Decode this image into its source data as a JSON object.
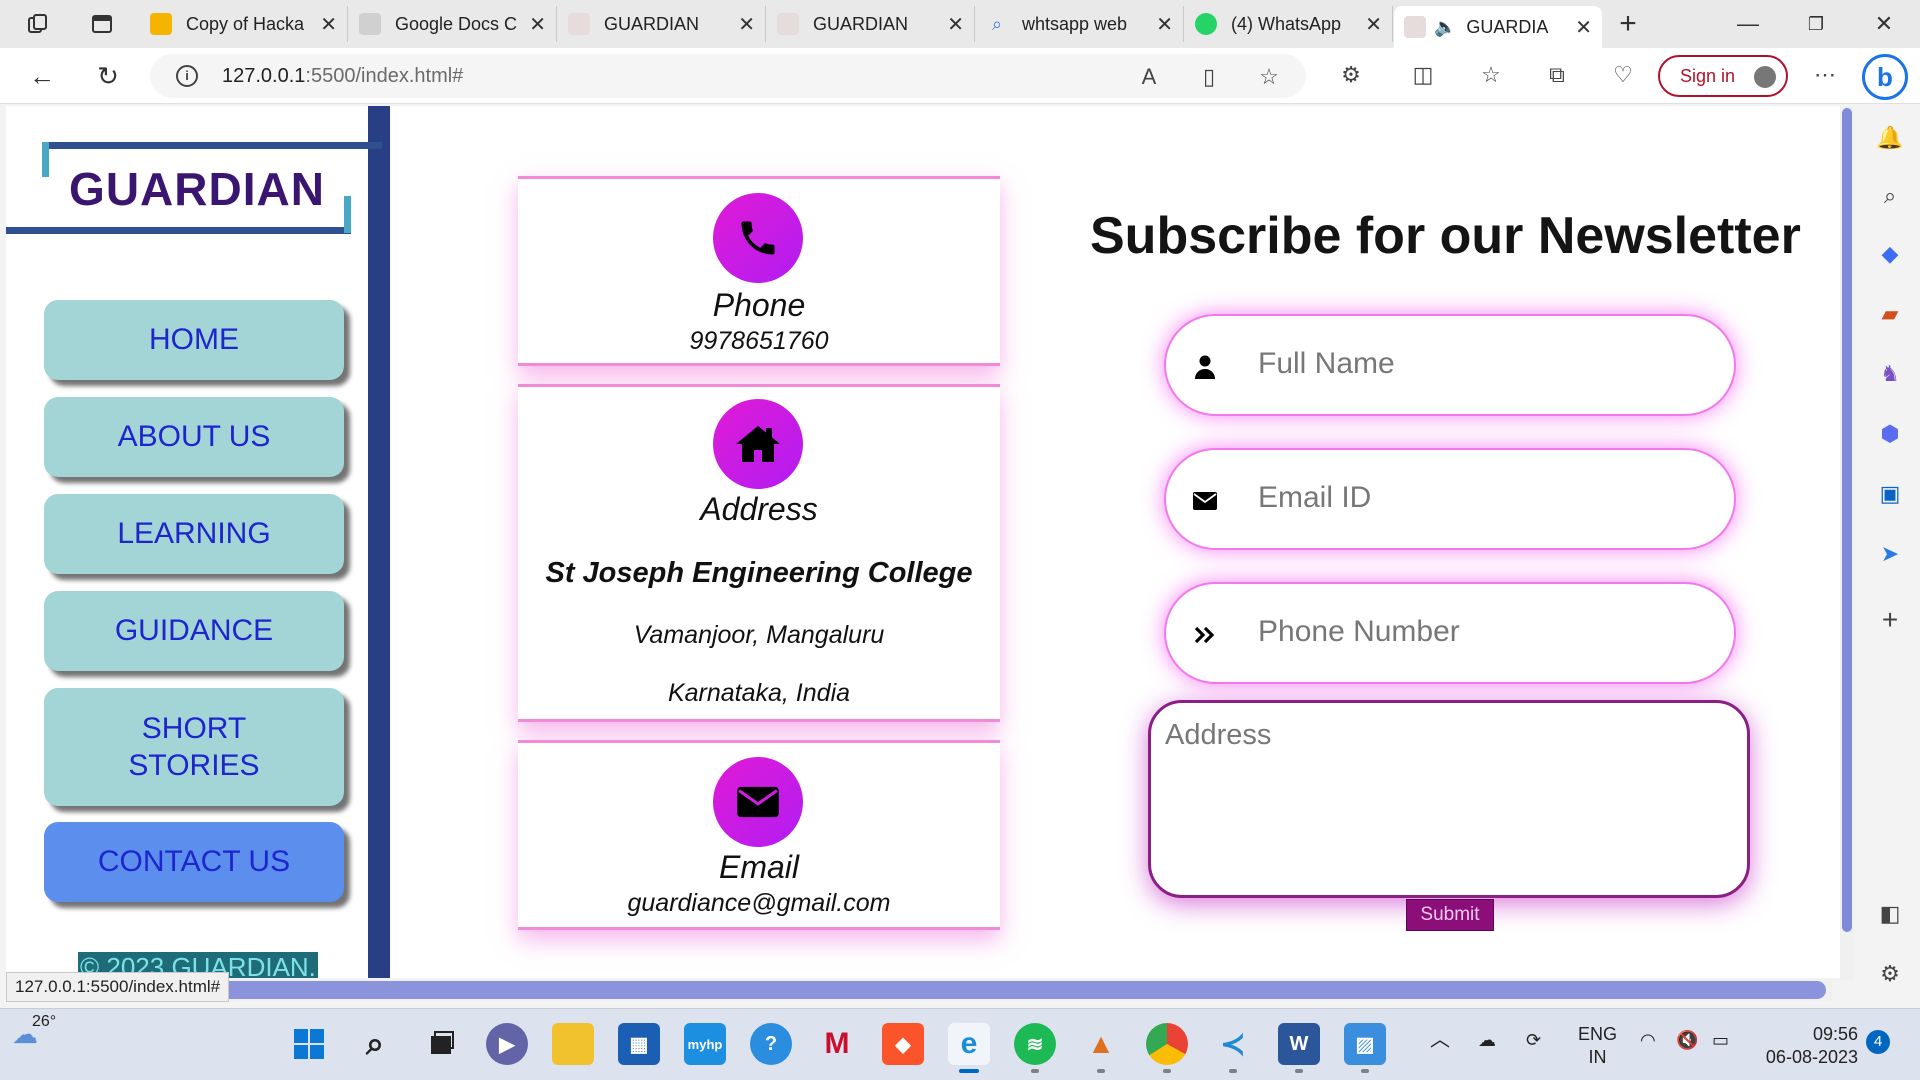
{
  "browser": {
    "tabs": [
      {
        "title": "Copy of Hacka",
        "favicon": "slides-icon",
        "color": "#f4b400"
      },
      {
        "title": "Google Docs C",
        "favicon": "docs-icon",
        "color": "#c0c0c0"
      },
      {
        "title": "GUARDIAN",
        "favicon": "page-icon",
        "color": "#d8c8c8"
      },
      {
        "title": "GUARDIAN",
        "favicon": "page-icon",
        "color": "#d8c8c8"
      },
      {
        "title": "whtsapp web",
        "favicon": "search-icon",
        "color": "#4a7fd8"
      },
      {
        "title": "(4) WhatsApp",
        "favicon": "whatsapp-icon",
        "color": "#25d366"
      },
      {
        "title": "GUARDIA",
        "favicon": "page-icon",
        "color": "#d8c8c8",
        "active": true
      }
    ],
    "url_host": "127.0.0.1",
    "url_path": ":5500/index.html#",
    "sign_in_label": "Sign in",
    "status_url": "127.0.0.1:5500/index.html#"
  },
  "site": {
    "logo": "GUARDIAN",
    "nav": [
      {
        "label": "HOME"
      },
      {
        "label": "ABOUT US"
      },
      {
        "label": "LEARNING"
      },
      {
        "label": "GUIDANCE"
      },
      {
        "label": "SHORT STORIES"
      },
      {
        "label": "CONTACT US",
        "active": true
      }
    ],
    "copyright": "© 2023 GUARDIAN.",
    "contact": {
      "phone": {
        "label": "Phone",
        "value": "9978651760"
      },
      "address": {
        "label": "Address",
        "line1": "St Joseph Engineering College",
        "line2": "Vamanjoor, Mangaluru",
        "line3": "Karnataka, India"
      },
      "email": {
        "label": "Email",
        "value": "guardiance@gmail.com"
      }
    },
    "newsletter": {
      "heading": "Subscribe for our Newsletter",
      "full_name_placeholder": "Full Name",
      "email_placeholder": "Email ID",
      "phone_placeholder": "Phone Number",
      "address_placeholder": "Address",
      "submit_label": "Submit"
    }
  },
  "colors": {
    "sidebar_border": "#283f86",
    "nav_button": "#a3d4d6",
    "nav_active": "#5b8eed",
    "nav_text": "#1d25cf",
    "icon_gradient": "#e01bd6",
    "glow": "#f07aeb",
    "submit": "#8c0e78"
  },
  "taskbar": {
    "weather_temp": "26°",
    "lang_line1": "ENG",
    "lang_line2": "IN",
    "time": "09:56",
    "date": "06-08-2023",
    "notification_count": "4"
  }
}
